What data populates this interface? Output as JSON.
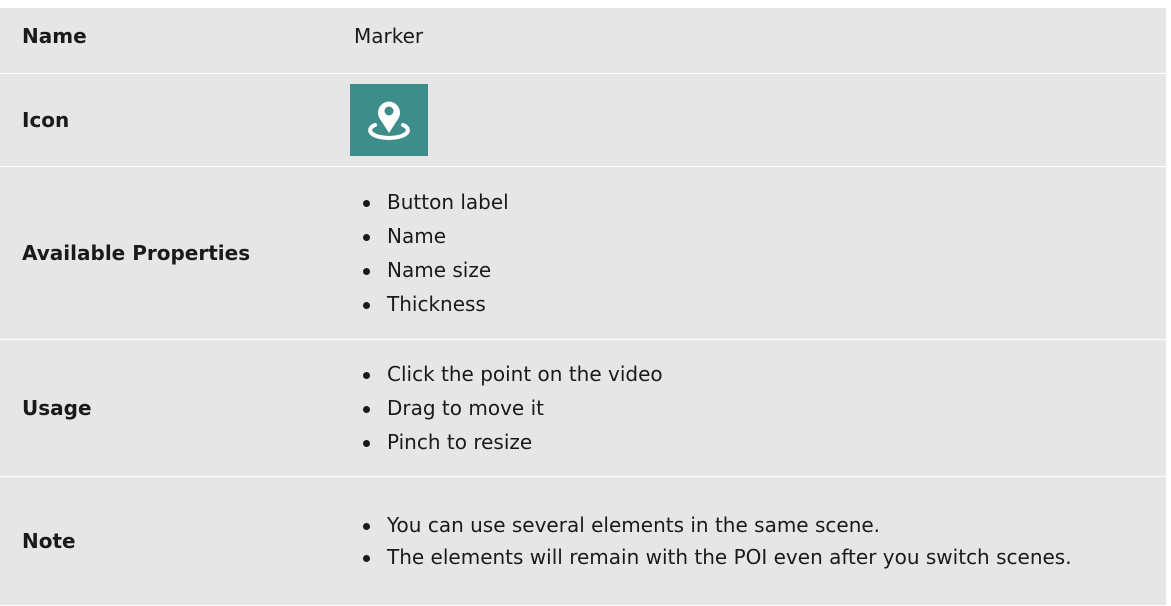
{
  "rows": {
    "name": {
      "label": "Name",
      "value": "Marker"
    },
    "icon": {
      "label": "Icon",
      "icon_name": "map-marker-location-icon",
      "icon_bg": "#3d8e8a"
    },
    "available_properties": {
      "label": "Available Properties",
      "items": [
        "Button label",
        "Name",
        "Name size",
        "Thickness"
      ]
    },
    "usage": {
      "label": "Usage",
      "items": [
        "Click the point on the video",
        "Drag to move it",
        "Pinch to resize"
      ]
    },
    "note": {
      "label": "Note",
      "items": [
        "You can use several elements in the same scene.",
        "The elements will remain with the POI even after you switch scenes."
      ]
    }
  },
  "colors": {
    "row_background": "#e6e6e6",
    "text": "#1a1a1a",
    "icon_accent": "#3d8e8a"
  }
}
